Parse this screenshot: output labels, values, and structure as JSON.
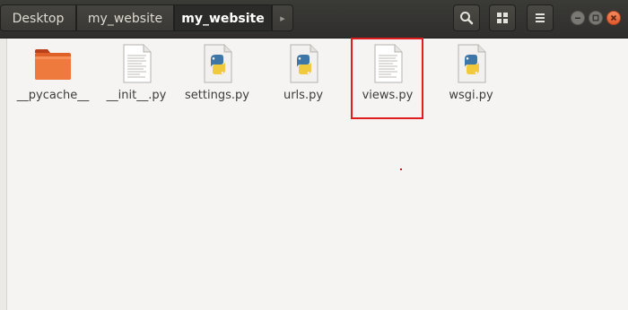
{
  "breadcrumbs": [
    {
      "label": "Desktop"
    },
    {
      "label": "my_website"
    },
    {
      "label": "my_website"
    }
  ],
  "breadcrumb_overflow_glyph": "▸",
  "header_buttons": {
    "search_icon": "search-icon",
    "view_icon": "grid-view-icon",
    "menu_icon": "hamburger-menu-icon"
  },
  "window_controls": {
    "minimize_glyph": "–",
    "maximize_glyph": "□",
    "close_glyph": "×"
  },
  "files": [
    {
      "name": "__pycache__",
      "icon": "folder-icon"
    },
    {
      "name": "__init__.py",
      "icon": "text-file-icon"
    },
    {
      "name": "settings.py",
      "icon": "python-file-icon"
    },
    {
      "name": "urls.py",
      "icon": "python-file-icon"
    },
    {
      "name": "views.py",
      "icon": "text-file-icon"
    },
    {
      "name": "wsgi.py",
      "icon": "python-file-icon"
    }
  ],
  "highlighted_file": "views.py",
  "colors": {
    "headerbar": "#2f2e2c",
    "background": "#f5f4f2",
    "close_button": "#e0592c",
    "highlight_box": "#e01e1e",
    "folder": "#e0602a",
    "python_blue": "#3e76a8",
    "python_yellow": "#f0c93d"
  }
}
